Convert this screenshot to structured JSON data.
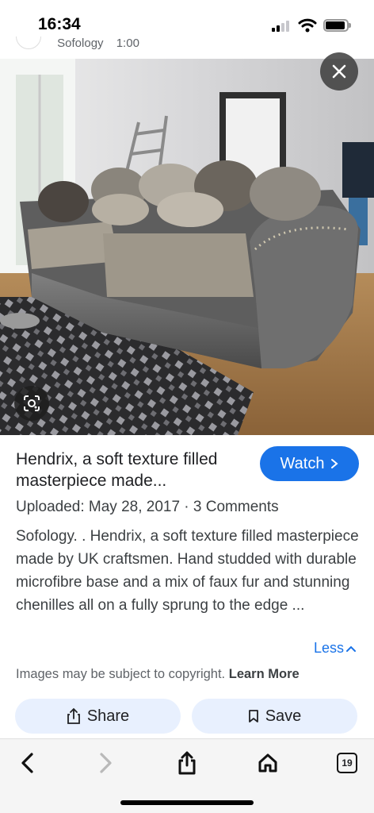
{
  "status": {
    "time": "16:34"
  },
  "source": {
    "name": "Sofology",
    "extra": "1:00"
  },
  "image": {
    "alt": "Grey sofa with patterned cushions in a living room"
  },
  "result": {
    "title": "Hendrix, a soft texture filled masterpiece made...",
    "watch_label": "Watch",
    "meta": "Uploaded: May 28, 2017 · 3 Comments",
    "description": "Sofology. . Hendrix, a soft texture filled masterpiece made by UK craftsmen. Hand studded with durable microfibre base and a mix of faux fur and stunning chenilles all on a fully sprung to the edge ...",
    "less_label": "Less",
    "copyright_text": "Images may be subject to copyright.",
    "learn_more_label": "Learn More"
  },
  "actions": {
    "share_label": "Share",
    "save_label": "Save"
  },
  "toolbar": {
    "tab_count": "19"
  },
  "icons": {
    "close": "close-icon",
    "lens": "lens-icon",
    "chevron": "chevron-right-icon",
    "share": "share-icon",
    "save": "bookmark-icon",
    "back": "back-icon",
    "forward": "forward-icon",
    "home": "home-icon",
    "tabs": "tabs-icon"
  },
  "colors": {
    "accent": "#1a73e8",
    "pill_bg": "#e8f0fe"
  }
}
